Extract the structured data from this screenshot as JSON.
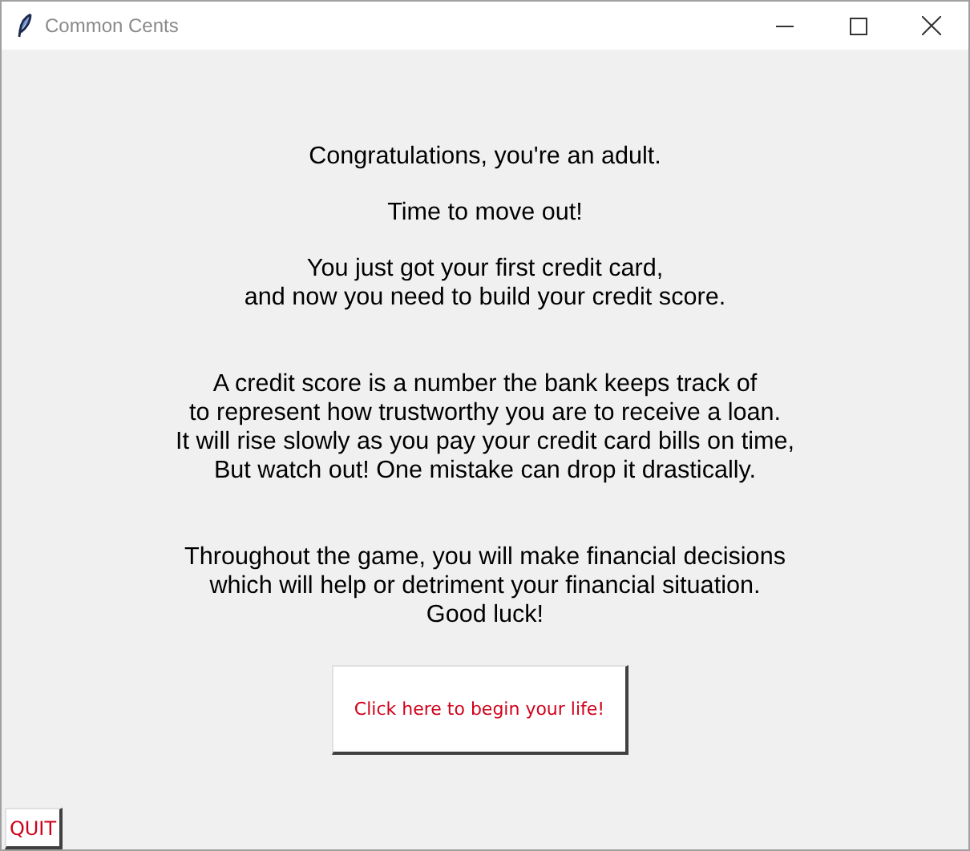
{
  "window": {
    "title": "Common Cents"
  },
  "paragraphs": [
    {
      "lines": [
        "Congratulations, you're an adult."
      ]
    },
    {
      "lines": [
        "Time to move out!"
      ]
    },
    {
      "lines": [
        "You just got your first credit card,",
        "and now you need to build your credit score."
      ]
    },
    {
      "lines": [
        "A credit score is a number the bank keeps track of",
        "to represent how trustworthy you are to receive a loan.",
        "It will rise slowly as you pay your credit card bills on time,",
        "But watch out! One mistake can drop it drastically."
      ]
    },
    {
      "lines": [
        "Throughout the game, you will make financial decisions",
        "which will help or detriment your financial situation.",
        "Good luck!"
      ]
    }
  ],
  "start_button": {
    "label": "Click here to begin your life!"
  },
  "quit_button": {
    "label": "QUIT"
  }
}
